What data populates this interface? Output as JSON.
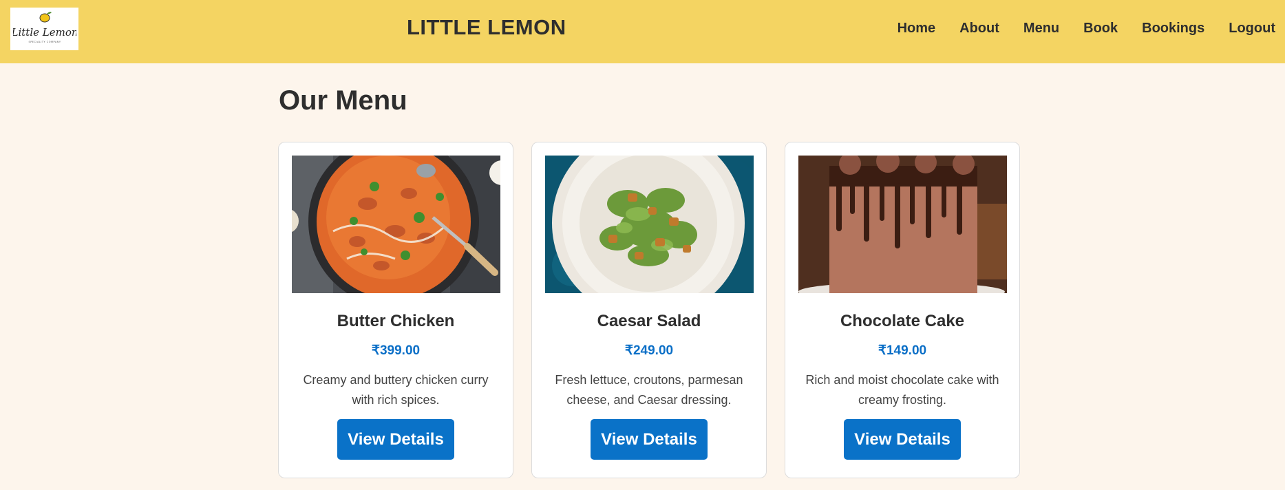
{
  "header": {
    "logo_text": "Little Lemon",
    "logo_subtext": "SPECIALITY COMPANY",
    "brand": "LITTLE LEMON",
    "nav": [
      "Home",
      "About",
      "Menu",
      "Book",
      "Bookings",
      "Logout"
    ]
  },
  "main": {
    "title": "Our Menu",
    "items": [
      {
        "name": "Butter Chicken",
        "price": "₹399.00",
        "description": "Creamy and buttery chicken curry with rich spices.",
        "button": "View Details",
        "image": "butter-chicken-photo"
      },
      {
        "name": "Caesar Salad",
        "price": "₹249.00",
        "description": "Fresh lettuce, croutons, parmesan cheese, and Caesar dressing.",
        "button": "View Details",
        "image": "caesar-salad-photo"
      },
      {
        "name": "Chocolate Cake",
        "price": "₹149.00",
        "description": "Rich and moist chocolate cake with creamy frosting.",
        "button": "View Details",
        "image": "chocolate-cake-photo"
      }
    ]
  },
  "colors": {
    "header_bg": "#f4d462",
    "page_bg": "#fdf5ec",
    "price": "#0b6fc7",
    "button": "#0a72c8"
  }
}
